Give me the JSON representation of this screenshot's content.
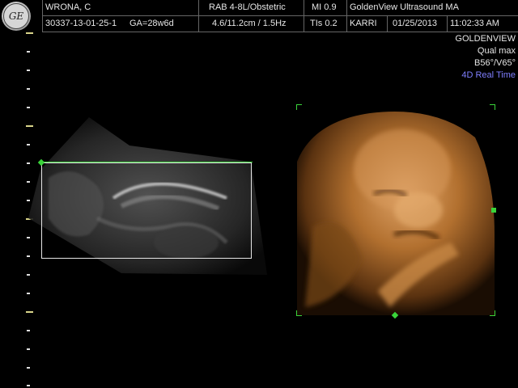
{
  "header": {
    "patient_name": "WRONA, C",
    "patient_id": "30337-13-01-25-1",
    "gestational_age": "GA=28w6d",
    "probe": "RAB 4-8L/Obstetric",
    "depth_freq": "4.6/11.2cm / 1.5Hz",
    "mi": "MI  0.9",
    "tis": "TIs  0.2",
    "institution": "GoldenView Ultrasound MA",
    "operator": "KARRI",
    "date": "01/25/2013",
    "time": "11:02:33 AM"
  },
  "logo": {
    "text": "GE"
  },
  "right_panel": {
    "mode": "GOLDENVIEW",
    "quality": "Qual max",
    "angles": "B56°/V65°",
    "render_mode": "4D Real Time"
  },
  "colors": {
    "background": "#000000",
    "roi_green": "#3ad43a",
    "text": "#e6e6e6",
    "render_mode_blue": "#7f7fff",
    "ruler_major": "#d9d58a",
    "render_tint": "#c4803a"
  },
  "icons": [
    "ge-logo-icon",
    "roi-handle-icon",
    "volume-handle-icon"
  ]
}
